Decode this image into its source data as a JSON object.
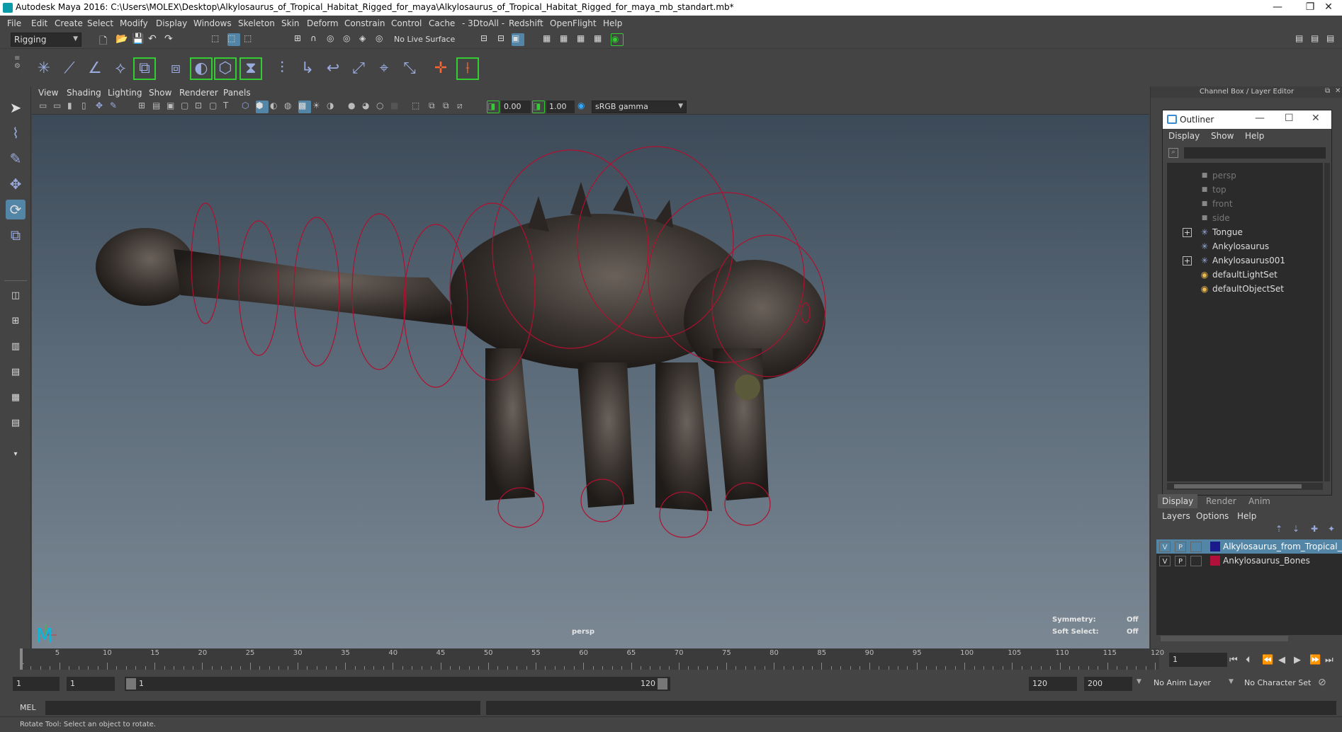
{
  "window": {
    "title": "Autodesk Maya 2016: C:\\Users\\MOLEX\\Desktop\\Alkylosaurus_of_Tropical_Habitat_Rigged_for_maya\\Alkylosaurus_of_Tropical_Habitat_Rigged_for_maya_mb_standart.mb*",
    "minimize": "—",
    "restore": "❐",
    "close": "✕"
  },
  "menubar": [
    "File",
    "Edit",
    "Create",
    "Select",
    "Modify",
    "Display",
    "Windows",
    "Skeleton",
    "Skin",
    "Deform",
    "Constrain",
    "Control",
    "Cache",
    "- 3DtoAll -",
    "Redshift",
    "OpenFlight",
    "Help"
  ],
  "statusline": {
    "menuset": "Rigging",
    "live_surface": "No Live Surface"
  },
  "viewport": {
    "menu": [
      "View",
      "Shading",
      "Lighting",
      "Show",
      "Renderer",
      "Panels"
    ],
    "exposure": "0.00",
    "gamma": "1.00",
    "colorspace": "sRGB gamma",
    "camera_label": "persp",
    "symmetry_label": "Symmetry:",
    "symmetry_value": "Off",
    "soft_select_label": "Soft Select:",
    "soft_select_value": "Off"
  },
  "right_panel": {
    "title": "Channel Box / Layer Editor"
  },
  "outliner": {
    "title": "Outliner",
    "menu": [
      "Display",
      "Show",
      "Help"
    ],
    "items": [
      {
        "label": "persp",
        "icon": "camera-icon",
        "dim": true,
        "expandable": false
      },
      {
        "label": "top",
        "icon": "camera-icon",
        "dim": true,
        "expandable": false
      },
      {
        "label": "front",
        "icon": "camera-icon",
        "dim": true,
        "expandable": false
      },
      {
        "label": "side",
        "icon": "camera-icon",
        "dim": true,
        "expandable": false
      },
      {
        "label": "Tongue",
        "icon": "joint-icon",
        "dim": false,
        "expandable": true
      },
      {
        "label": "Ankylosaurus",
        "icon": "joint-icon",
        "dim": false,
        "expandable": false
      },
      {
        "label": "Ankylosaurus001",
        "icon": "joint-icon",
        "dim": false,
        "expandable": true
      },
      {
        "label": "defaultLightSet",
        "icon": "set-icon",
        "dim": false,
        "expandable": false
      },
      {
        "label": "defaultObjectSet",
        "icon": "set-icon",
        "dim": false,
        "expandable": false
      }
    ]
  },
  "layer_editor": {
    "tabs": [
      "Display",
      "Render",
      "Anim"
    ],
    "menu": [
      "Layers",
      "Options",
      "Help"
    ],
    "layers": [
      {
        "v": "V",
        "p": "P",
        "color": "#1a1a8a",
        "name": "Alkylosaurus_from_Tropical_Hab",
        "selected": true
      },
      {
        "v": "V",
        "p": "P",
        "color": "#b0103a",
        "name": "Ankylosaurus_Bones",
        "selected": false
      }
    ]
  },
  "timeline": {
    "ticks": [
      "5",
      "10",
      "15",
      "20",
      "25",
      "30",
      "35",
      "40",
      "45",
      "50",
      "55",
      "60",
      "65",
      "70",
      "75",
      "80",
      "85",
      "90",
      "95",
      "100",
      "105",
      "110",
      "115",
      "120"
    ],
    "start_label": "1",
    "current_frame": "1"
  },
  "range": {
    "start": "1",
    "playback_start": "1",
    "slider_start": "1",
    "slider_end": "120",
    "playback_end": "120",
    "end": "200",
    "anim_layer": "No Anim Layer",
    "character_set": "No Character Set"
  },
  "command_line": {
    "label": "MEL"
  },
  "help_line": {
    "text": "Rotate Tool: Select an object to rotate."
  },
  "colors": {
    "accent": "#5285a6",
    "rig_curves": "#b01030"
  }
}
